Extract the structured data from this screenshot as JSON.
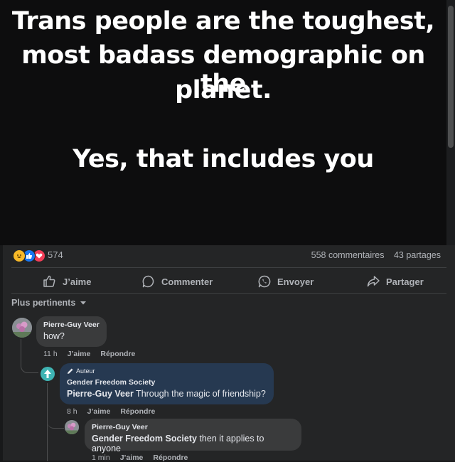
{
  "post": {
    "image_lines": [
      "Trans people are the toughest,",
      "most badass demographic on the",
      "planet.",
      "Yes, that includes you"
    ]
  },
  "stats": {
    "reactions_count": "574",
    "comments": "558 commentaires",
    "shares": "43 partages",
    "reaction_icons": [
      "haha-icon",
      "like-icon",
      "love-icon"
    ]
  },
  "actions": {
    "like": "J’aime",
    "comment": "Commenter",
    "send": "Envoyer",
    "share": "Partager"
  },
  "sort": {
    "label": "Plus pertinents"
  },
  "comments": [
    {
      "author": "Pierre-Guy Veer",
      "text": "how?",
      "time": "11 h",
      "like": "J’aime",
      "reply": "Répondre"
    },
    {
      "badge": "Auteur",
      "author": "Gender Freedom Society",
      "mention": "Pierre-Guy Veer",
      "text": " Through the magic of friendship?",
      "time": "8 h",
      "like": "J’aime",
      "reply": "Répondre"
    },
    {
      "author": "Pierre-Guy Veer",
      "mention": "Gender Freedom Society",
      "text": " then it applies to anyone",
      "time": "1 min",
      "like": "J’aime",
      "reply": "Répondre"
    }
  ],
  "colors": {
    "author_bubble": "#263951",
    "bubble": "#3a3b3c",
    "accent": "#2d88ff"
  }
}
